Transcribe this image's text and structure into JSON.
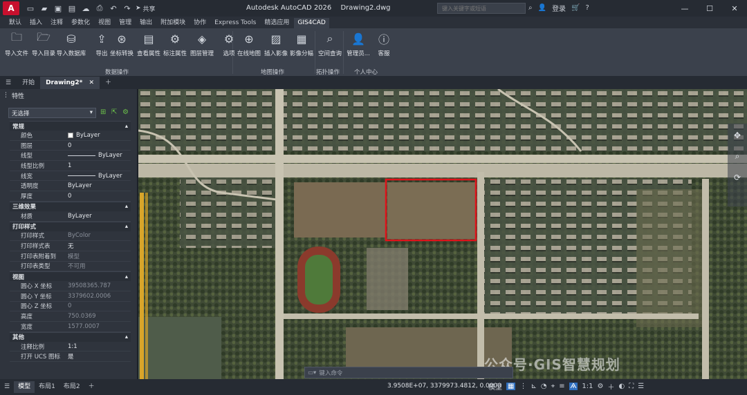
{
  "app": {
    "title": "Autodesk AutoCAD 2026",
    "document": "Drawing2.dwg",
    "logo_letter": "A",
    "share_label": "共享",
    "search_placeholder": "键入关键字或短语",
    "user_label": "登录"
  },
  "ribbon_tabs": [
    "默认",
    "插入",
    "注释",
    "参数化",
    "视图",
    "管理",
    "输出",
    "附加模块",
    "协作",
    "Express Tools",
    "精选应用",
    "GIS4CAD"
  ],
  "active_ribbon_tab": "GIS4CAD",
  "ribbon": {
    "data_ops": {
      "label": "数据操作",
      "buttons": [
        "导入文件",
        "导入目录",
        "导入数据库",
        "导出",
        "坐标转换",
        "查看属性",
        "标注属性",
        "图层管理",
        "选项"
      ]
    },
    "map_ops": {
      "label": "地图操作",
      "buttons": [
        "在线地图",
        "插入影像",
        "影像分幅"
      ]
    },
    "topo_ops": {
      "label": "拓扑操作",
      "buttons": [
        "空间查询"
      ]
    },
    "user_center": {
      "label": "个人中心",
      "buttons": [
        "管理员...",
        "客服"
      ]
    }
  },
  "doc_tabs": {
    "start": "开始",
    "active": "Drawing2*"
  },
  "properties": {
    "title": "特性",
    "selection": "无选择",
    "sections": [
      {
        "name": "常规",
        "rows": [
          {
            "k": "颜色",
            "v": "ByLayer",
            "kind": "color"
          },
          {
            "k": "图层",
            "v": "0"
          },
          {
            "k": "线型",
            "v": "ByLayer",
            "kind": "line"
          },
          {
            "k": "线型比例",
            "v": "1"
          },
          {
            "k": "线宽",
            "v": "ByLayer",
            "kind": "line"
          },
          {
            "k": "透明度",
            "v": "ByLayer"
          },
          {
            "k": "厚度",
            "v": "0"
          }
        ]
      },
      {
        "name": "三维效果",
        "rows": [
          {
            "k": "材质",
            "v": "ByLayer"
          }
        ]
      },
      {
        "name": "打印样式",
        "rows": [
          {
            "k": "打印样式",
            "v": "ByColor",
            "dim": true
          },
          {
            "k": "打印样式表",
            "v": "无"
          },
          {
            "k": "打印表附着到",
            "v": "模型",
            "dim": true
          },
          {
            "k": "打印表类型",
            "v": "不可用",
            "dim": true
          }
        ]
      },
      {
        "name": "视图",
        "rows": [
          {
            "k": "圆心 X 坐标",
            "v": "39508365.787",
            "dim": true
          },
          {
            "k": "圆心 Y 坐标",
            "v": "3379602.0006",
            "dim": true
          },
          {
            "k": "圆心 Z 坐标",
            "v": "0",
            "dim": true
          },
          {
            "k": "高度",
            "v": "750.0369",
            "dim": true
          },
          {
            "k": "宽度",
            "v": "1577.0007",
            "dim": true
          }
        ]
      },
      {
        "name": "其他",
        "rows": [
          {
            "k": "注释比例",
            "v": "1:1"
          },
          {
            "k": "打开 UCS 图标",
            "v": "是"
          }
        ]
      }
    ]
  },
  "command_prompt": "键入命令",
  "status": {
    "tabs": [
      "模型",
      "布局1",
      "布局2"
    ],
    "coords": "3.9508E+07, 3379973.4812, 0.0000",
    "mode": "模型",
    "scale": "1:1"
  },
  "watermark": "公众号·GIS智慧规划",
  "colors": {
    "accent": "#2f6fbf",
    "selection_rect": "#e0131b",
    "brand": "#c8102e"
  }
}
